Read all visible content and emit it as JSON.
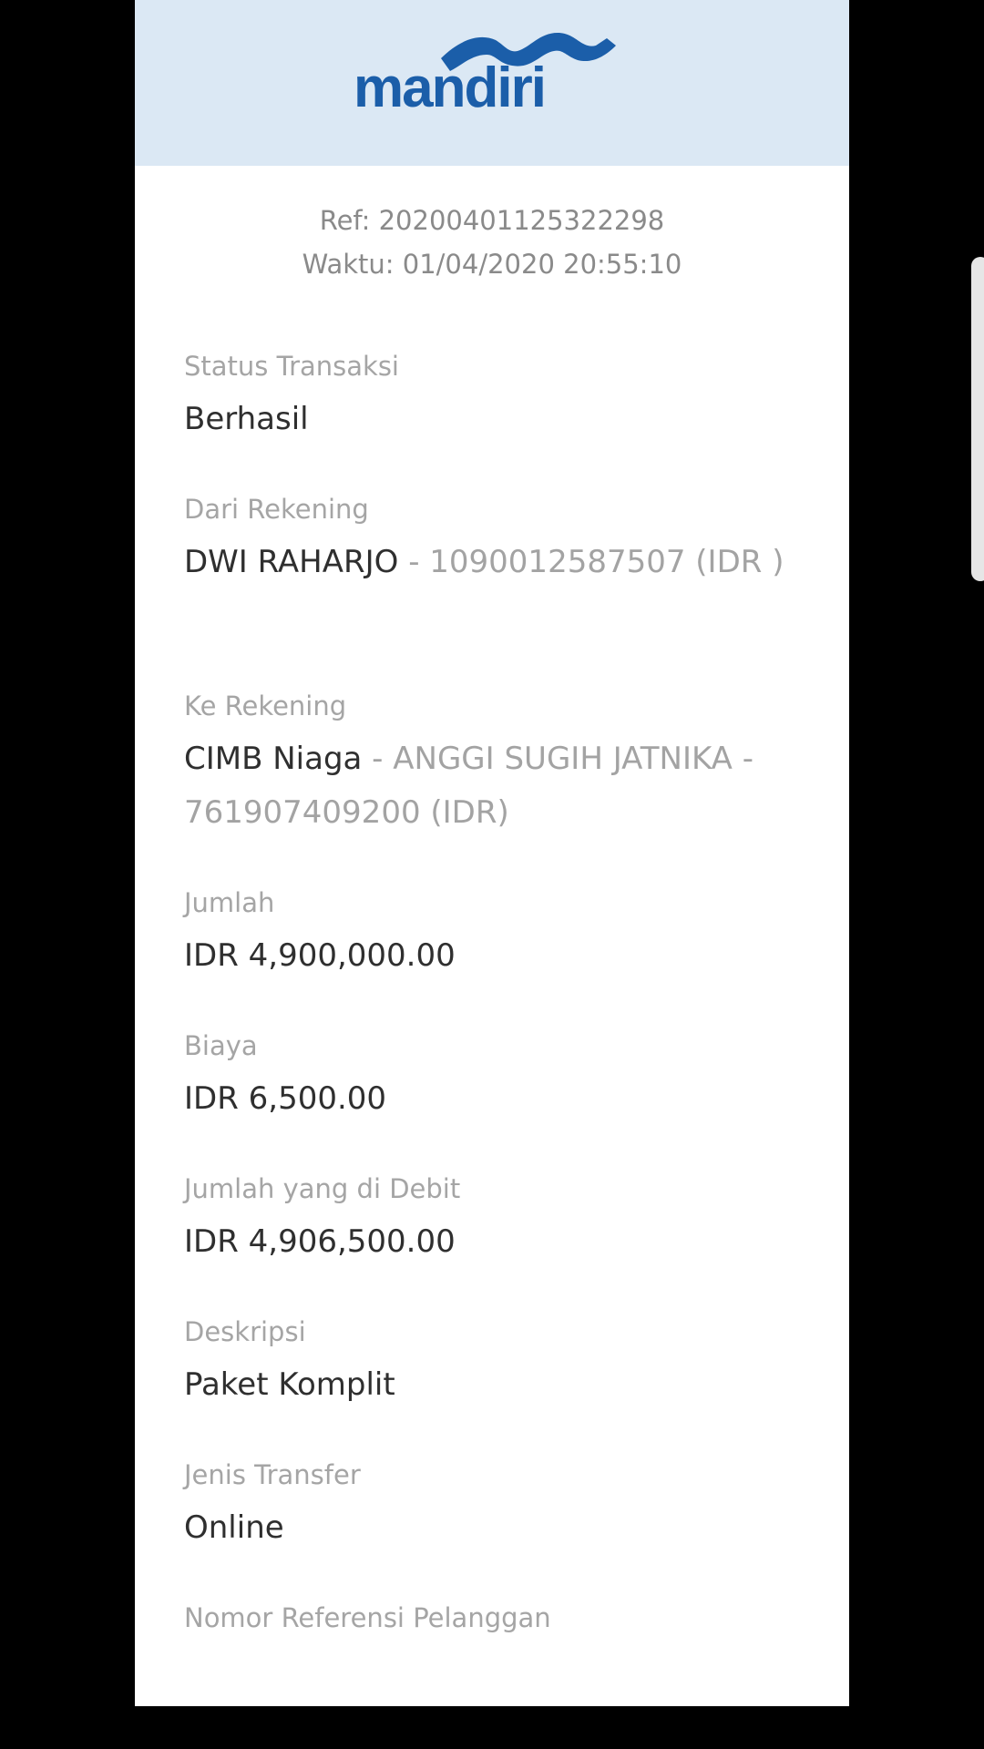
{
  "header": {
    "logo_text": "mandiri",
    "logo_color": "#1b5ea9",
    "background": "#dbe8f4"
  },
  "meta": {
    "ref": "Ref: 20200401125322298",
    "time": "Waktu: 01/04/2020 20:55:10"
  },
  "fields": {
    "status": {
      "label": "Status Transaksi",
      "value": "Berhasil"
    },
    "from": {
      "label": "Dari Rekening",
      "name": "DWI RAHARJO",
      "detail": " - 1090012587507 (IDR )"
    },
    "to": {
      "label": "Ke Rekening",
      "bank": "CIMB Niaga",
      "detail": " - ANGGI SUGIH JATNIKA - 761907409200 (IDR)"
    },
    "amount": {
      "label": "Jumlah",
      "value": "IDR 4,900,000.00"
    },
    "fee": {
      "label": "Biaya",
      "value": "IDR 6,500.00"
    },
    "debited": {
      "label": "Jumlah yang di Debit",
      "value": "IDR 4,906,500.00"
    },
    "description": {
      "label": "Deskripsi",
      "value": "Paket Komplit"
    },
    "transfer_type": {
      "label": "Jenis Transfer",
      "value": "Online"
    },
    "customer_ref": {
      "label": "Nomor Referensi Pelanggan"
    }
  }
}
